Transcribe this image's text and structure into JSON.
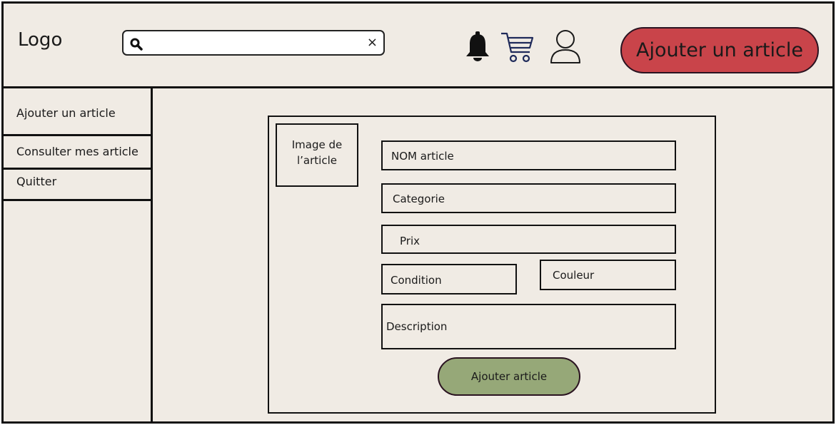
{
  "header": {
    "logo": "Logo",
    "search": {
      "value": "",
      "clear": "×"
    },
    "icons": [
      "bell-icon",
      "cart-icon",
      "user-icon",
      "search-icon"
    ],
    "add_button": "Ajouter un article"
  },
  "sidebar": {
    "items": [
      {
        "label": "Ajouter un article"
      },
      {
        "label": "Consulter mes article"
      },
      {
        "label": "Quitter"
      }
    ]
  },
  "form": {
    "image_box": {
      "line1": "Image de",
      "line2": "l’article"
    },
    "fields": {
      "nom": "NOM article",
      "categorie": "Categorie",
      "prix": "Prix",
      "condition": "Condition",
      "couleur": "Couleur",
      "description": "Description"
    },
    "submit": "Ajouter article"
  },
  "colors": {
    "background": "#f0ebe4",
    "add_button": "#c9444a",
    "submit_button": "#96a878"
  }
}
